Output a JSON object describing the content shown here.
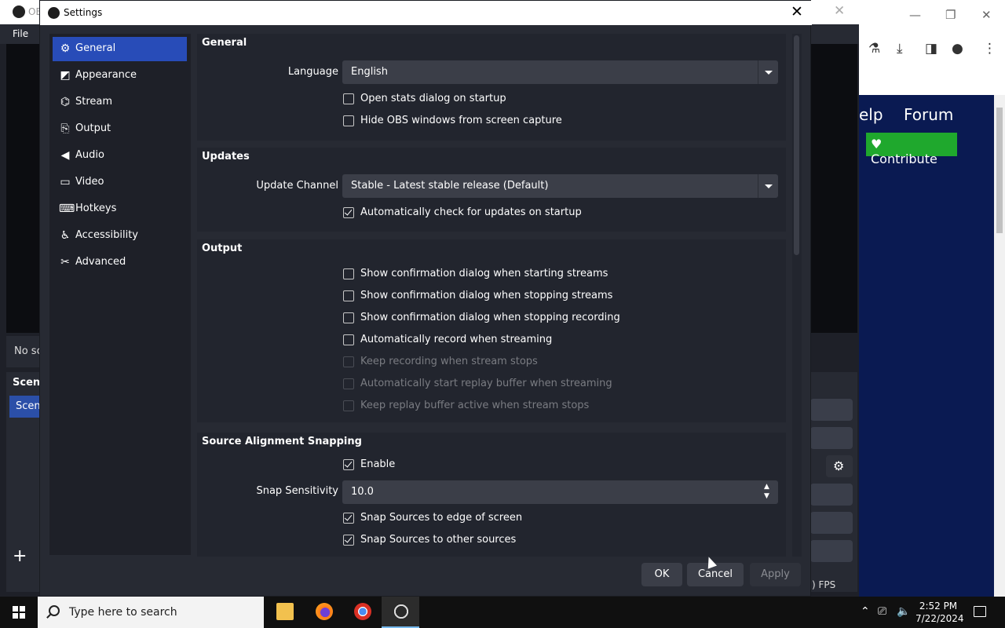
{
  "background_app": {
    "title_fragment": "OE",
    "menu_file": "File",
    "no_scene_text": "No sc",
    "scenes_header": "Scene",
    "scene_selected": "Scene",
    "fps_text": ") FPS"
  },
  "browser": {
    "nav_help": "elp",
    "nav_forum": "Forum",
    "contribute_label": "Contribute",
    "accent_green": "#1fa82d"
  },
  "settings": {
    "window_title": "Settings",
    "sidebar": [
      {
        "label": "General",
        "icon": "gear-icon"
      },
      {
        "label": "Appearance",
        "icon": "appearance-icon"
      },
      {
        "label": "Stream",
        "icon": "stream-antenna-icon"
      },
      {
        "label": "Output",
        "icon": "output-icon"
      },
      {
        "label": "Audio",
        "icon": "audio-icon"
      },
      {
        "label": "Video",
        "icon": "monitor-icon"
      },
      {
        "label": "Hotkeys",
        "icon": "keyboard-icon"
      },
      {
        "label": "Accessibility",
        "icon": "accessibility-icon"
      },
      {
        "label": "Advanced",
        "icon": "wrench-icon"
      }
    ],
    "active_sidebar_item": "General",
    "general": {
      "title": "General",
      "language_label": "Language",
      "language_value": "English",
      "open_stats_label": "Open stats dialog on startup",
      "open_stats_checked": false,
      "hide_obs_label": "Hide OBS windows from screen capture",
      "hide_obs_checked": false
    },
    "updates": {
      "title": "Updates",
      "channel_label": "Update Channel",
      "channel_value": "Stable - Latest stable release (Default)",
      "auto_check_label": "Automatically check for updates on startup",
      "auto_check_checked": true
    },
    "output": {
      "title": "Output",
      "options": [
        {
          "label": "Show confirmation dialog when starting streams",
          "checked": false,
          "enabled": true
        },
        {
          "label": "Show confirmation dialog when stopping streams",
          "checked": false,
          "enabled": true
        },
        {
          "label": "Show confirmation dialog when stopping recording",
          "checked": false,
          "enabled": true
        },
        {
          "label": "Automatically record when streaming",
          "checked": false,
          "enabled": true
        },
        {
          "label": "Keep recording when stream stops",
          "checked": false,
          "enabled": false
        },
        {
          "label": "Automatically start replay buffer when streaming",
          "checked": false,
          "enabled": false
        },
        {
          "label": "Keep replay buffer active when stream stops",
          "checked": false,
          "enabled": false
        }
      ]
    },
    "snapping": {
      "title": "Source Alignment Snapping",
      "enable_label": "Enable",
      "enable_checked": true,
      "sensitivity_label": "Snap Sensitivity",
      "sensitivity_value": "10.0",
      "edge_label": "Snap Sources to edge of screen",
      "edge_checked": true,
      "other_label": "Snap Sources to other sources",
      "other_checked": true
    },
    "buttons": {
      "ok": "OK",
      "cancel": "Cancel",
      "apply": "Apply"
    },
    "accent_color": "#284cb8"
  },
  "taskbar": {
    "search_placeholder": "Type here to search",
    "time": "2:52 PM",
    "date": "7/22/2024",
    "apps": [
      "file-explorer-icon",
      "firefox-icon",
      "chrome-icon",
      "obs-icon"
    ]
  }
}
